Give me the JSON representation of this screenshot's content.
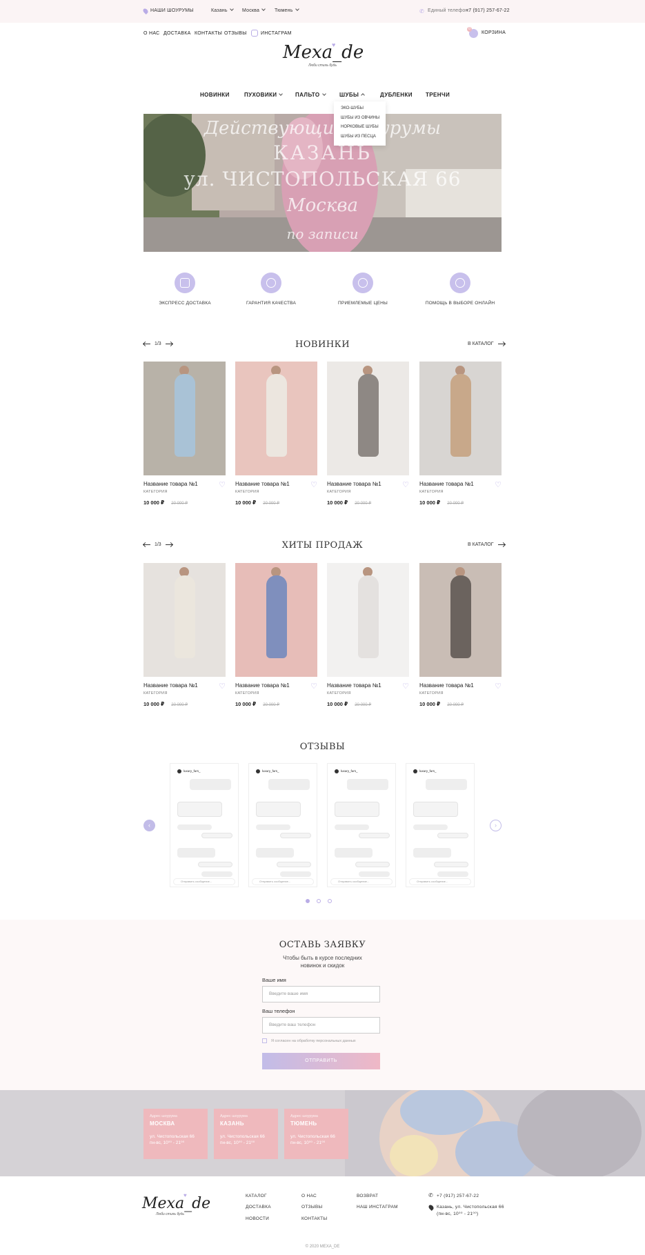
{
  "topbar": {
    "showrooms_label": "НАШИ ШОУРУМЫ",
    "cities": [
      "Казань",
      "Москва",
      "Тюмень"
    ],
    "phone_label": "Единый телефон:",
    "phone": "+7 (917) 257-67-22"
  },
  "nav": {
    "links": [
      "О НАС",
      "ДОСТАВКА",
      "КОНТАКТЫ",
      "ОТЗЫВЫ"
    ],
    "instagram": "ИНСТАГРАМ",
    "cart": "КОРЗИНА",
    "cart_count": "0"
  },
  "logo": {
    "name": "Mexa_de",
    "tagline": "Люби стиль будь"
  },
  "menu": {
    "items": [
      "НОВИНКИ",
      "ПУХОВИКИ",
      "ПАЛЬТО",
      "ШУБЫ",
      "ДУБЛЕНКИ",
      "ТРЕНЧИ"
    ],
    "dropdown": [
      "ЭКО-ШУБЫ",
      "ШУБЫ ИЗ ОВЧИНЫ",
      "НОРКОВЫЕ ШУБЫ",
      "ШУБЫ ИЗ ПЕСЦА"
    ]
  },
  "hero": {
    "line1": "Действующий шоурумы",
    "line2": "КАЗАНЬ",
    "line3": "ул. ЧИСТОПОЛЬСКАЯ 66",
    "line4": "Москва",
    "line5": "по записи"
  },
  "features": [
    "ЭКСПРЕСС ДОСТАВКА",
    "ГАРАНТИЯ КАЧЕСТВА",
    "ПРИЕМЛЕМЫЕ ЦЕНЫ",
    "ПОМОЩЬ В ВЫБОРЕ ОНЛАЙН"
  ],
  "sections": {
    "new_title": "НОВИНКИ",
    "hits_title": "ХИТЫ ПРОДАЖ",
    "pager": "1/3",
    "catalog_link": "В КАТАЛОГ",
    "reviews_title": "ОТЗЫВЫ"
  },
  "product": {
    "name": "Название товара №1",
    "category": "КАТЕГОРИЯ",
    "price": "10 000 ₽",
    "old_price": "20 000 ₽"
  },
  "product_colors": {
    "new": [
      "#a9c2d6",
      "#ece6df",
      "#8e8884",
      "#c8a88a"
    ],
    "hits": [
      "#ebe6dd",
      "#7f8fbd",
      "#e4e1df",
      "#6b635e"
    ],
    "new_bg": [
      "#b8b2a8",
      "#e9c5be",
      "#ece9e6",
      "#d8d5d2"
    ],
    "hits_bg": [
      "#e6e2de",
      "#e7bdb8",
      "#f2f1f0",
      "#c9bdb5"
    ]
  },
  "review": {
    "user": "luxury_furs_",
    "input_placeholder": "Отправить сообщение..."
  },
  "form": {
    "title": "ОСТАВЬ ЗАЯВКУ",
    "subtitle1": "Чтобы быть в курсе последних",
    "subtitle2": "новинок и скидок",
    "name_label": "Ваше имя",
    "name_placeholder": "Введите ваше имя",
    "phone_label": "Ваш телефон",
    "phone_placeholder": "Введите ваш телефон",
    "consent": "Я согласен на обработку персональных данных",
    "submit": "ОТПРАВИТЬ"
  },
  "showrooms": [
    {
      "label": "Адрес шоурума",
      "city": "МОСКВА",
      "address": "ул. Чистопольская 66",
      "hours": "пн-вс, 10⁰⁰ - 21⁰⁰"
    },
    {
      "label": "Адрес шоурума",
      "city": "КАЗАНЬ",
      "address": "ул. Чистопольская 66",
      "hours": "пн-вс, 10⁰⁰ - 21⁰⁰"
    },
    {
      "label": "Адрес шоурума",
      "city": "ТЮМЕНЬ",
      "address": "ул. Чистопольская 66",
      "hours": "пн-вс, 10⁰⁰ - 21⁰⁰"
    }
  ],
  "footer": {
    "col1": [
      "КАТАЛОГ",
      "ДОСТАВКА",
      "НОВОСТИ"
    ],
    "col2": [
      "О НАС",
      "ОТЗЫВЫ",
      "КОНТАКТЫ"
    ],
    "col3": [
      "ВОЗВРАТ",
      "НАШ ИНСТАГРАМ"
    ],
    "phone": "+7 (917) 257-67-22",
    "address1": "Казань, ул. Чистопольская 66",
    "address2": "(пн-вс, 10⁰⁰ - 21⁰⁰)",
    "copyright": "© 2020 MEXA_DE"
  },
  "colors": {
    "accent": "#c2bce8",
    "pink": "#efb9bd",
    "topbar": "#fbf4f5"
  }
}
